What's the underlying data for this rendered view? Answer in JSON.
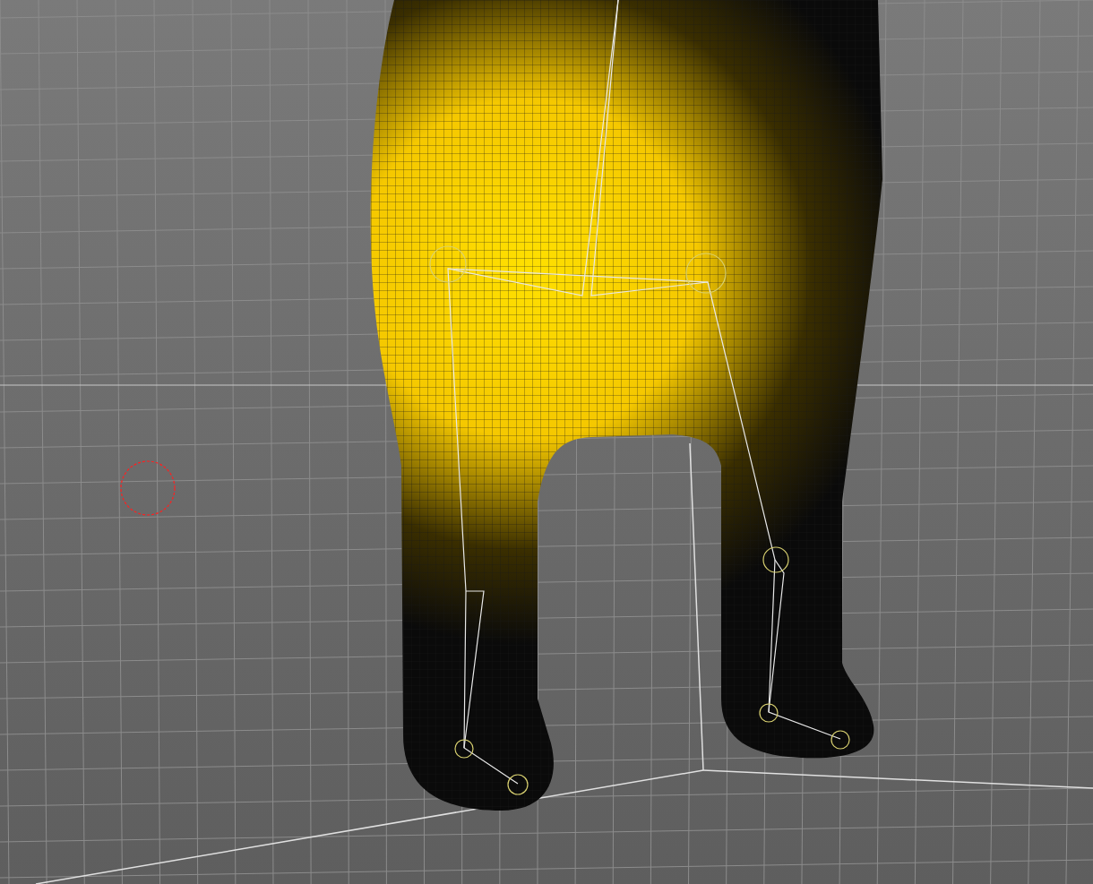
{
  "viewport": {
    "show_grid": true,
    "show_wireframe": true,
    "show_skeleton": true,
    "show_brush_cursor": true
  }
}
